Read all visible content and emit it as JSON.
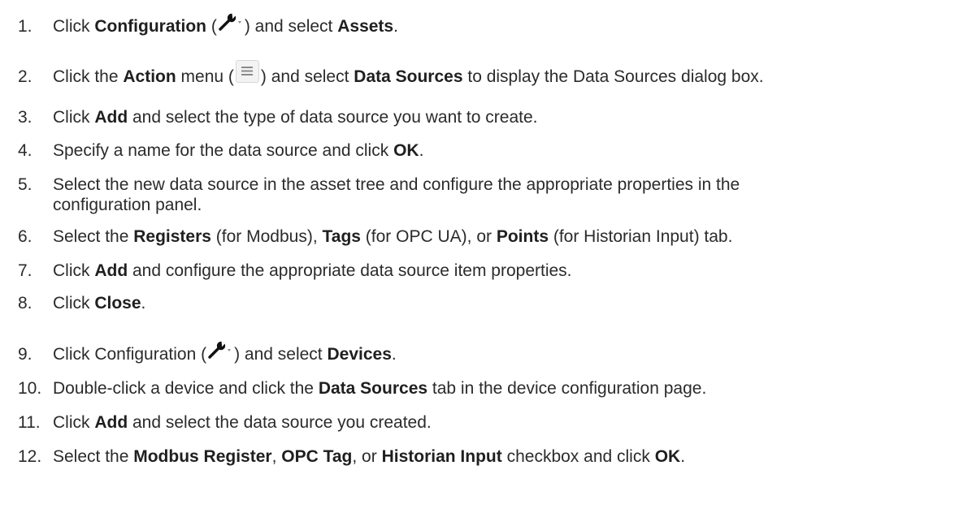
{
  "steps": [
    {
      "num": "1.",
      "parts": [
        {
          "t": "Click "
        },
        {
          "b": "Configuration"
        },
        {
          "t": " ("
        },
        {
          "icon": "wrench-icon"
        },
        {
          "t": ") and select "
        },
        {
          "b": "Assets"
        },
        {
          "t": "."
        }
      ]
    },
    {
      "num": "2.",
      "parts": [
        {
          "t": "Click the "
        },
        {
          "b": "Action"
        },
        {
          "t": " menu ("
        },
        {
          "icon": "menu-icon"
        },
        {
          "t": ") and select "
        },
        {
          "b": "Data Sources"
        },
        {
          "t": " to display the Data Sources dialog box."
        }
      ]
    },
    {
      "num": "3.",
      "parts": [
        {
          "t": "Click "
        },
        {
          "b": "Add"
        },
        {
          "t": " and select the type of data source you want to create."
        }
      ]
    },
    {
      "num": "4.",
      "parts": [
        {
          "t": "Specify a name for the data source and click "
        },
        {
          "b": "OK"
        },
        {
          "t": "."
        }
      ]
    },
    {
      "num": "5.",
      "parts": [
        {
          "t": "Select the new data source in the asset tree and configure the appropriate properties in the"
        }
      ]
    },
    {
      "num": "",
      "parts": [
        {
          "t": "configuration panel."
        }
      ]
    },
    {
      "num": "6.",
      "parts": [
        {
          "t": "Select the "
        },
        {
          "b": "Registers"
        },
        {
          "t": " (for Modbus), "
        },
        {
          "b": "Tags"
        },
        {
          "t": " (for OPC UA), or "
        },
        {
          "b": "Points"
        },
        {
          "t": " (for Historian Input) tab."
        }
      ]
    },
    {
      "num": "7.",
      "parts": [
        {
          "t": "Click "
        },
        {
          "b": "Add"
        },
        {
          "t": " and configure the appropriate data source item properties."
        }
      ]
    },
    {
      "num": "8.",
      "parts": [
        {
          "t": "Click "
        },
        {
          "b": "Close"
        },
        {
          "t": "."
        }
      ]
    },
    {
      "num": "9.",
      "parts": [
        {
          "t": "Click Configuration ("
        },
        {
          "icon": "wrench-icon"
        },
        {
          "t": ") and select "
        },
        {
          "b": "Devices"
        },
        {
          "t": "."
        }
      ]
    },
    {
      "num": "10.",
      "parts": [
        {
          "t": "Double-click a device and click the "
        },
        {
          "b": "Data Sources"
        },
        {
          "t": " tab in the device configuration page."
        }
      ]
    },
    {
      "num": "11.",
      "parts": [
        {
          "t": "Click "
        },
        {
          "b": "Add"
        },
        {
          "t": " and select the data source you created."
        }
      ]
    },
    {
      "num": "12.",
      "parts": [
        {
          "t": "Select the "
        },
        {
          "b": "Modbus Register"
        },
        {
          "t": ", "
        },
        {
          "b": "OPC Tag"
        },
        {
          "t": ", or "
        },
        {
          "b": "Historian Input"
        },
        {
          "t": " checkbox and click "
        },
        {
          "b": "OK"
        },
        {
          "t": "."
        }
      ]
    }
  ]
}
